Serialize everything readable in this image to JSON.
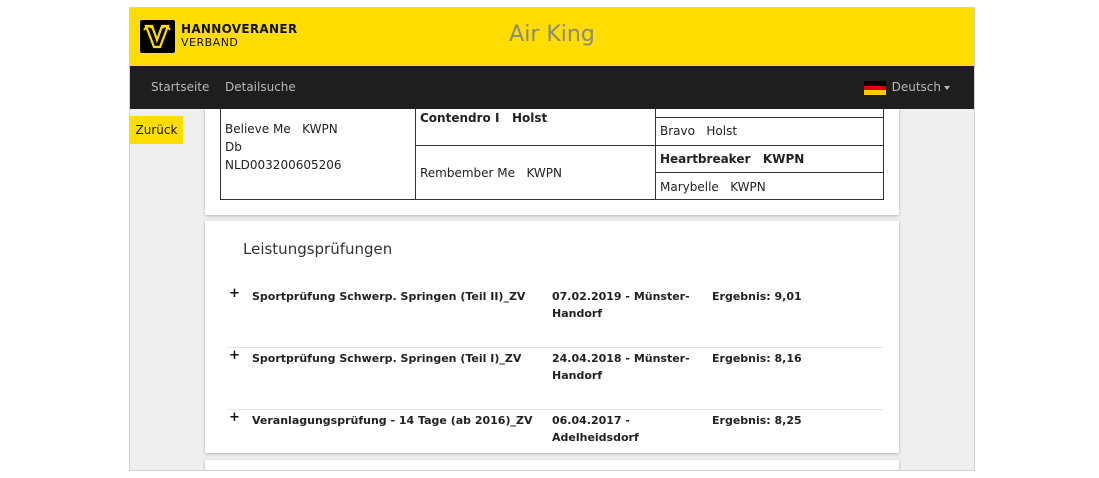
{
  "header": {
    "brand_line1": "HANNOVERANER",
    "brand_line2": "VERBAND",
    "title": "Air King",
    "accent_color": "#ffdd00"
  },
  "nav": {
    "items": [
      {
        "label": "Startseite"
      },
      {
        "label": "Detailsuche"
      }
    ],
    "language": {
      "label": "Deutsch",
      "flag_icon": "german-flag-icon"
    }
  },
  "back_button": {
    "label": "Zurück"
  },
  "pedigree": {
    "dam": {
      "name": "Believe Me   KWPN",
      "line2": "Db",
      "id": "NLD003200605206"
    },
    "dam_sire": {
      "name": "Contendro I   Holst"
    },
    "dam_dam": {
      "name": "Rembember Me   KWPN"
    },
    "g_sire_dam": {
      "name": "Bravo   Holst"
    },
    "g_dam_sire": {
      "name": "Heartbreaker   KWPN"
    },
    "g_dam_dam": {
      "name": "Marybelle   KWPN"
    }
  },
  "performance": {
    "title": "Leistungsprüfungen",
    "rows": [
      {
        "expand_icon": "plus-icon",
        "name": "Sportprüfung Schwerp. Springen (Teil II)_ZV",
        "date_place": "07.02.2019 - Münster-Handorf",
        "result": "Ergebnis: 9,01"
      },
      {
        "expand_icon": "plus-icon",
        "name": "Sportprüfung Schwerp. Springen (Teil I)_ZV",
        "date_place": "24.04.2018 - Münster-Handorf",
        "result": "Ergebnis: 8,16"
      },
      {
        "expand_icon": "plus-icon",
        "name": "Veranlagungsprüfung - 14 Tage (ab 2016)_ZV",
        "date_place": "06.04.2017 - Adelheidsdorf",
        "result": "Ergebnis: 8,25"
      }
    ]
  }
}
